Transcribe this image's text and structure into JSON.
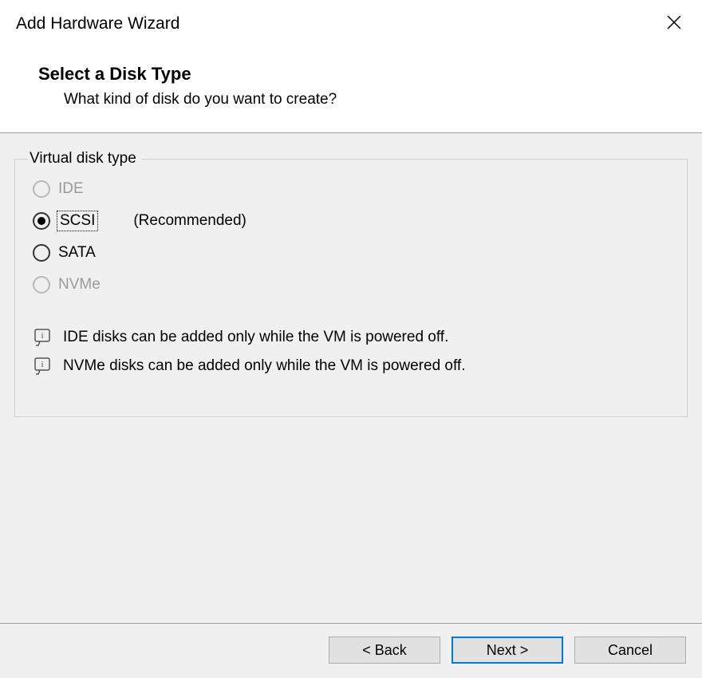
{
  "title": "Add Hardware Wizard",
  "header": {
    "heading": "Select a Disk Type",
    "subheading": "What kind of disk do you want to create?"
  },
  "group": {
    "legend": "Virtual disk type",
    "options": {
      "ide": "IDE",
      "scsi": "SCSI",
      "sata": "SATA",
      "nvme": "NVMe"
    },
    "recommended": "(Recommended)",
    "info": {
      "ide": "IDE disks can be added only while the VM is powered off.",
      "nvme": "NVMe disks can be added only while the VM is powered off."
    }
  },
  "buttons": {
    "back": "< Back",
    "next": "Next >",
    "cancel": "Cancel"
  }
}
